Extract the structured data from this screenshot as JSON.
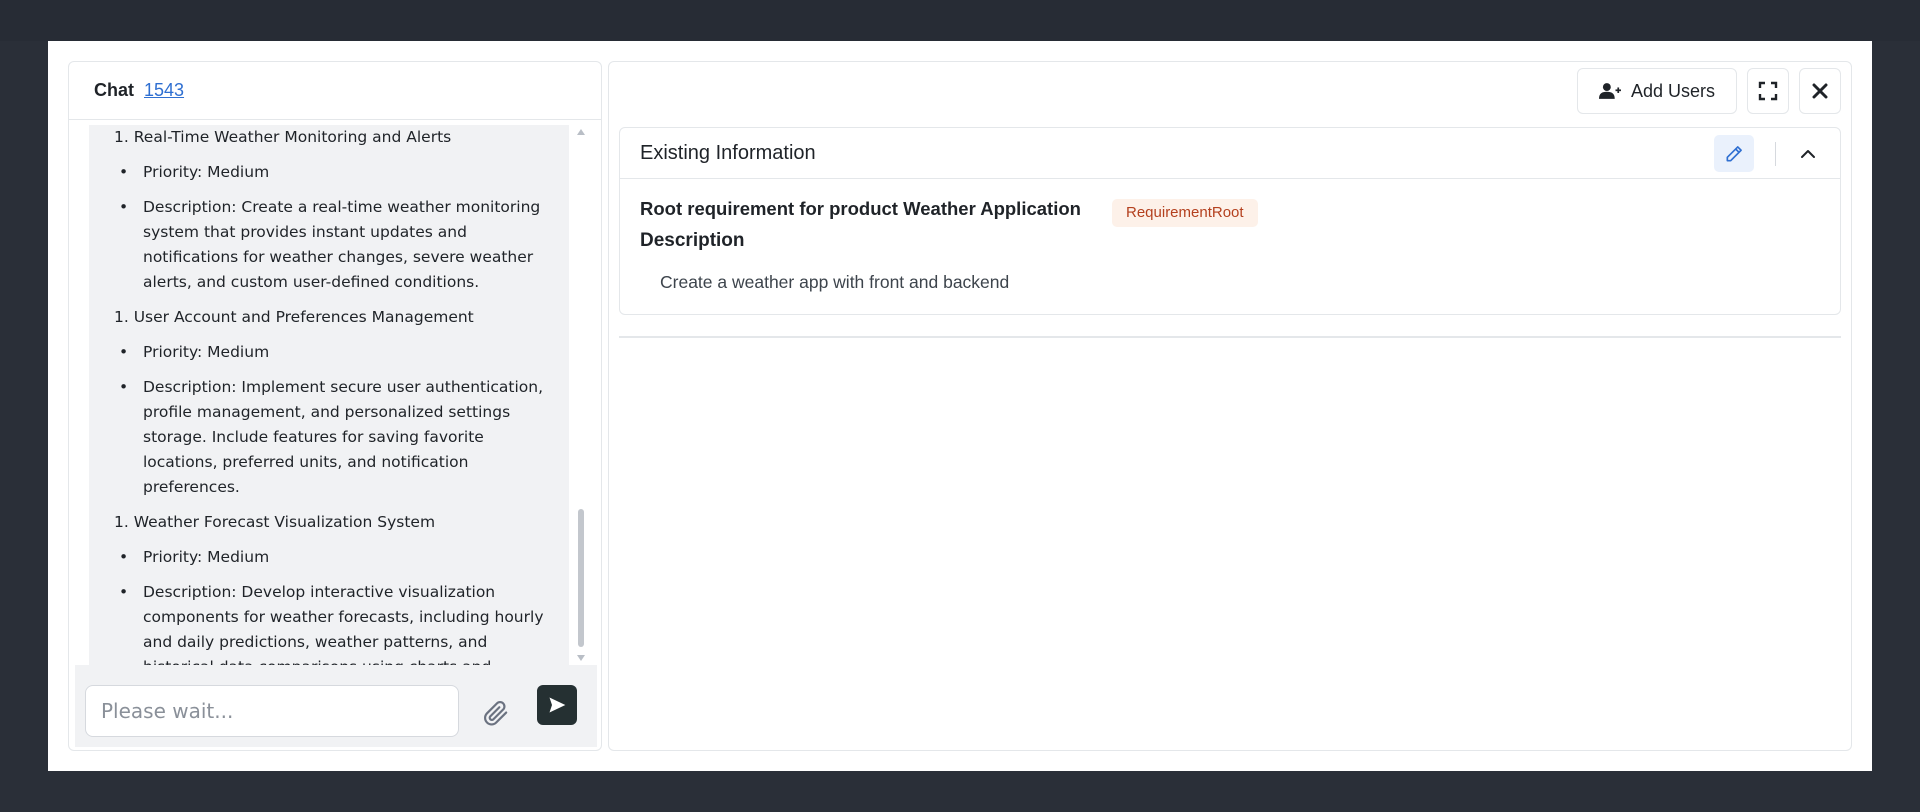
{
  "chat": {
    "title": "Chat",
    "id_link": "1543",
    "messages": [
      {
        "heading": "1. Real-Time Weather Monitoring and Alerts",
        "bullets": [
          "Priority: Medium",
          "Description: Create a real-time weather monitoring system that provides instant updates and notifications for weather changes, severe weather alerts, and custom user-defined conditions."
        ]
      },
      {
        "heading": "1. User Account and Preferences Management",
        "bullets": [
          "Priority: Medium",
          "Description: Implement secure user authentication, profile management, and personalized settings storage. Include features for saving favorite locations, preferred units, and notification preferences."
        ]
      },
      {
        "heading": "1. Weather Forecast Visualization System",
        "bullets": [
          "Priority: Medium",
          "Description: Develop interactive visualization components for weather forecasts, including hourly and daily predictions, weather patterns, and historical data comparisons using charts and graphs."
        ]
      }
    ],
    "input_placeholder": "Please wait...",
    "attach_icon": "paperclip-icon",
    "send_icon": "send-icon"
  },
  "toolbar": {
    "add_users_label": "Add Users",
    "add_users_icon": "user-plus-icon",
    "fullscreen_icon": "expand-icon",
    "close_icon": "close-icon"
  },
  "info": {
    "card_title": "Existing Information",
    "edit_icon": "pencil-icon",
    "collapse_icon": "chevron-up-icon",
    "requirement_title": "Root requirement for product Weather Application",
    "requirement_badge": "RequirementRoot",
    "description_label": "Description",
    "description_text": "Create a weather app with front and backend"
  },
  "colors": {
    "accent_link": "#2f6fd1",
    "send_button": "#253032",
    "badge_bg": "#fdf1e9",
    "badge_text": "#b4401e",
    "edit_button_bg": "#eaf1fc",
    "backdrop": "#2a2f38"
  }
}
